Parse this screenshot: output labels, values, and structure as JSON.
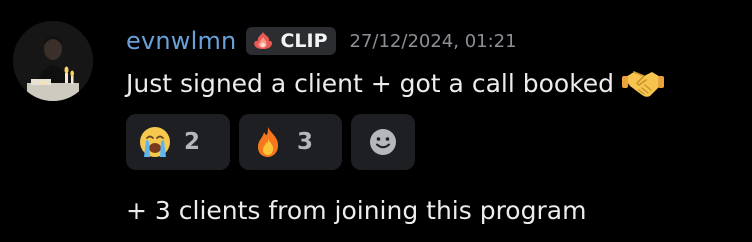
{
  "message": {
    "username": "evnwlmn",
    "clan_tag": {
      "icon": "flame-burst-icon",
      "name": "CLIP"
    },
    "timestamp": "27/12/2024, 01:21",
    "text": "Just signed a client + got a call booked",
    "text_emoji": "handshake-icon",
    "followup_text": "+ 3 clients from joining this program"
  },
  "reactions": [
    {
      "icon": "loudly-crying-face-icon",
      "count": "2"
    },
    {
      "icon": "fire-icon",
      "count": "3"
    }
  ],
  "add_reaction": {
    "icon": "smiley-add-reaction-icon"
  },
  "colors": {
    "background": "#000000",
    "username": "#6aa0d8",
    "reaction_bg": "#1e1f22",
    "clan_bg": "#2b2d31",
    "timestamp": "#8c8f96"
  }
}
